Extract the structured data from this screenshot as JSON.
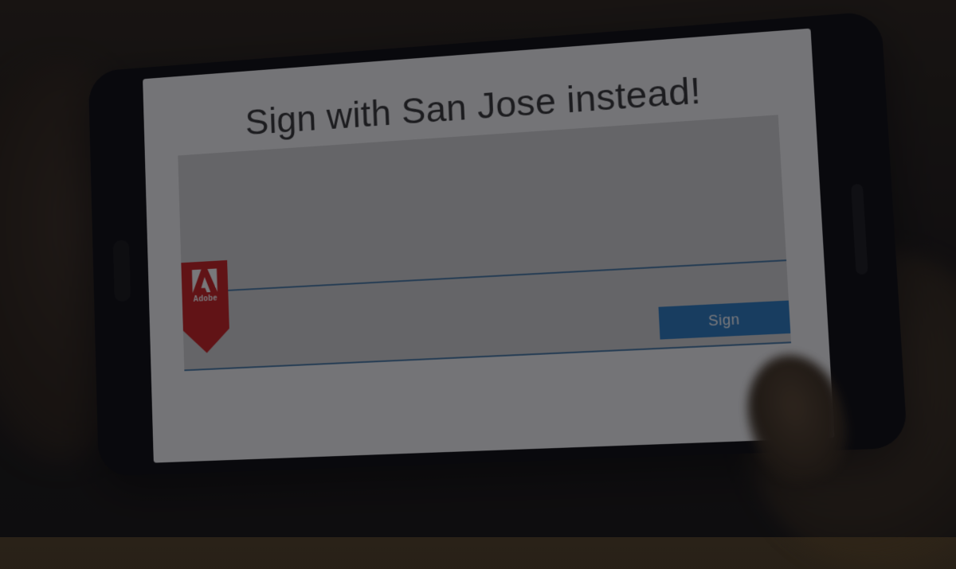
{
  "screen": {
    "headline": "Sign with San Jose instead!",
    "brand_label": "Adobe",
    "sign_button_label": "Sign"
  },
  "colors": {
    "adobe_red": "#cc1f1f",
    "button_blue": "#2b7cc4",
    "line_blue": "#4a7ca8",
    "panel_gray": "#d4d4d4"
  }
}
